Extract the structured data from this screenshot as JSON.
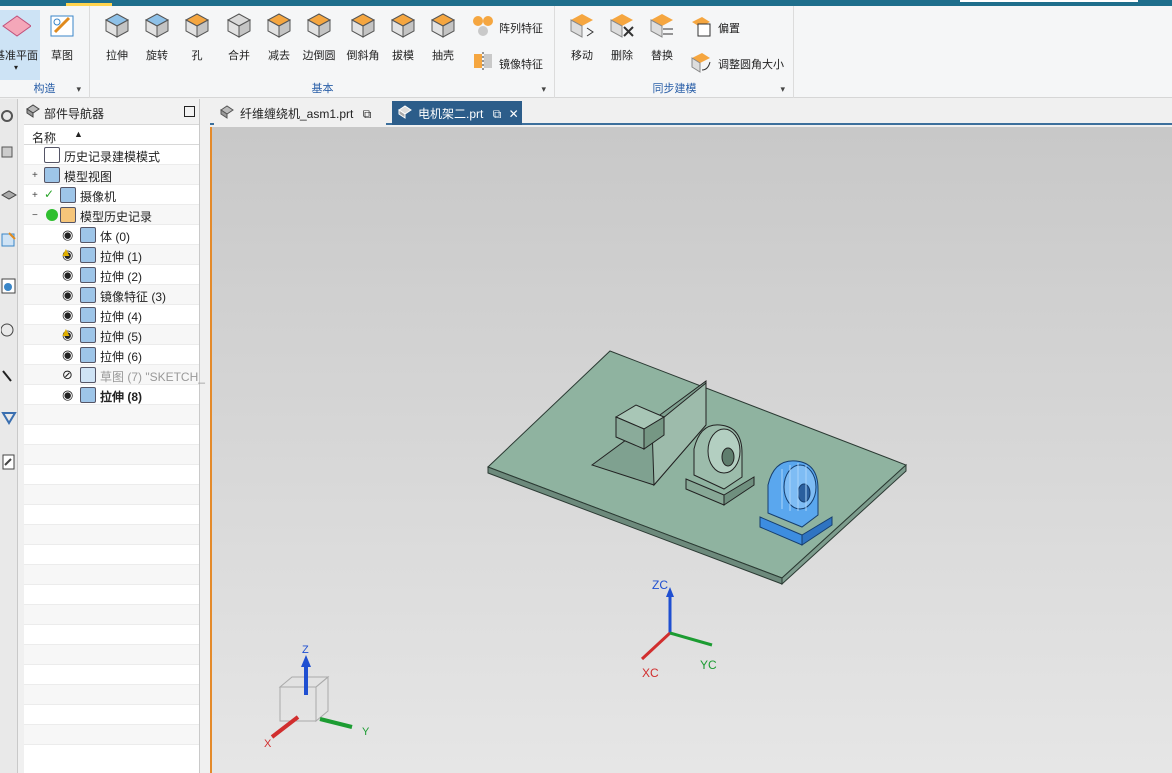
{
  "ribbon": {
    "construct_group": {
      "label": "构造",
      "datum_plane": "基准平面",
      "sketch": "草图"
    },
    "basic_group": {
      "label": "基本",
      "tools": [
        "拉伸",
        "旋转",
        "孔",
        "合并",
        "减去",
        "边倒圆",
        "倒斜角",
        "拔模",
        "抽壳"
      ],
      "pattern_feature": "阵列特征",
      "mirror_feature": "镜像特征"
    },
    "sync_group": {
      "label": "同步建模",
      "move": "移动",
      "delete": "删除",
      "replace": "替换",
      "offset": "偏置",
      "resize_blend": "调整圆角大小"
    }
  },
  "navigator": {
    "title": "部件导航器",
    "column": "名称",
    "rows": [
      {
        "label": "历史记录建模模式"
      },
      {
        "label": "模型视图"
      },
      {
        "label": "摄像机"
      },
      {
        "label": "模型历史记录"
      },
      {
        "label": "体 (0)"
      },
      {
        "label": "拉伸 (1)"
      },
      {
        "label": "拉伸 (2)"
      },
      {
        "label": "镜像特征 (3)"
      },
      {
        "label": "拉伸 (4)"
      },
      {
        "label": "拉伸 (5)"
      },
      {
        "label": "拉伸 (6)"
      },
      {
        "label": "草图 (7) \"SKETCH_"
      },
      {
        "label": "拉伸 (8)"
      }
    ]
  },
  "tabs": [
    {
      "label": "纤维缠绕机_asm1.prt"
    },
    {
      "label": "电机架二.prt"
    }
  ],
  "viewport": {
    "triad_labels": {
      "zc": "ZC",
      "xc": "XC",
      "yc": "YC"
    },
    "cube_labels": {
      "z": "Z",
      "x": "X",
      "y": "Y"
    }
  }
}
